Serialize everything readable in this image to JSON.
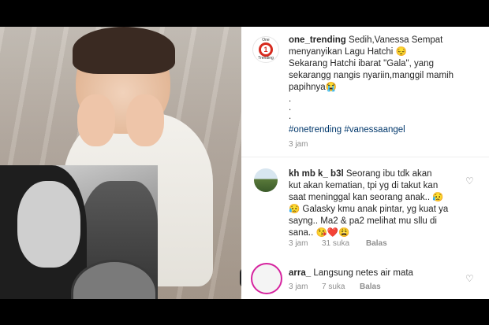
{
  "post": {
    "username": "one_trending",
    "caption_line1": "Sedih,Vanessa Sempat",
    "caption_line2": "menyanyikan Lagu Hatchi 😔",
    "caption_line3": "Sekarang Hatchi ibarat \"Gala\", yang",
    "caption_line4": "sekarangg nangis nyariin,manggil mamih",
    "caption_line5": "papihnya😭",
    "dot1": ".",
    "dot2": ".",
    "dot3": ".",
    "hashtags": "#onetrending #vanessaangel",
    "time": "3 jam",
    "logo_top": "One",
    "logo_mark": "1",
    "logo_bottom": "Trending"
  },
  "comments": [
    {
      "username": "kh mb k_ b3l",
      "line1": "Seorang ibu tdk akan",
      "line2": "kut akan kematian, tpi yg di takut kan",
      "line3": "saat meninggal kan seorang anak.. 😥",
      "line4": "😥 Galasky kmu anak pintar, yg kuat ya",
      "line5": "sayng.. Ma2 & pa2 melihat mu sllu di",
      "line6": "sana.. 😘❤️😩",
      "time": "3 jam",
      "likes": "31 suka",
      "reply": "Balas"
    },
    {
      "username": "arra_",
      "line1": "Langsung netes air mata",
      "time": "3 jam",
      "likes": "7 suka",
      "reply": "Balas"
    }
  ],
  "icons": {
    "heart": "heart-outline-icon"
  },
  "colors": {
    "hashtag": "#00376b",
    "meta": "#8e8e8e",
    "logo_red": "#d62a1e"
  }
}
